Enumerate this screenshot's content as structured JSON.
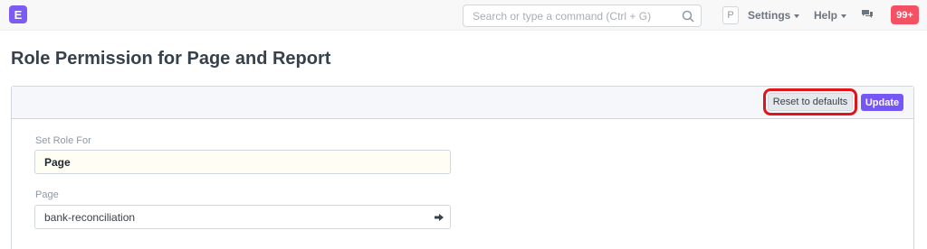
{
  "navbar": {
    "logo_letter": "E",
    "search_placeholder": "Search or type a command (Ctrl + G)",
    "avatar_letter": "P",
    "settings_label": "Settings",
    "help_label": "Help",
    "notifications_count": "99+"
  },
  "page": {
    "title": "Role Permission for Page and Report"
  },
  "toolbar": {
    "reset_label": "Reset to defaults",
    "update_label": "Update"
  },
  "form": {
    "set_role_label": "Set Role For",
    "set_role_value": "Page",
    "page_label": "Page",
    "page_value": "bank-reconciliation"
  },
  "colors": {
    "accent": "#7557f5",
    "badge": "#f45264",
    "highlight": "#e0151b"
  }
}
